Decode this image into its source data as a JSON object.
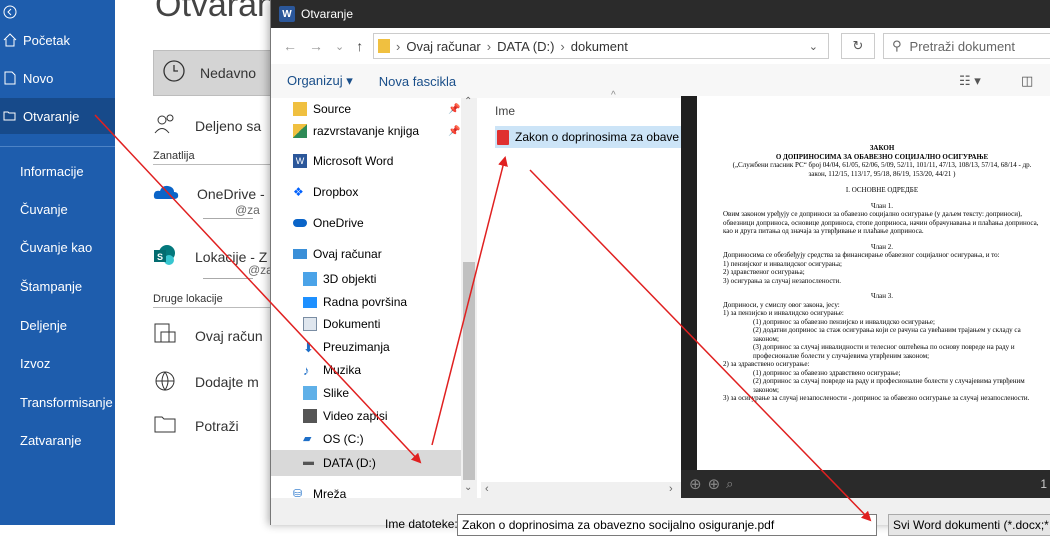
{
  "backstage": {
    "title": "Otvaranje",
    "nav": [
      {
        "label": "Početak",
        "icon": "home-icon"
      },
      {
        "label": "Novo",
        "icon": "new-document-icon"
      },
      {
        "label": "Otvaranje",
        "icon": "open-folder-icon",
        "selected": true
      },
      {
        "label": "Informacije"
      },
      {
        "label": "Čuvanje"
      },
      {
        "label": "Čuvanje kao"
      },
      {
        "label": "Štampanje"
      },
      {
        "label": "Deljenje"
      },
      {
        "label": "Izvoz"
      },
      {
        "label": "Transformisanje"
      },
      {
        "label": "Zatvaranje"
      }
    ],
    "recent_label": "Nedavno",
    "shared_label": "Deljeno sa",
    "group_zanatlija": "Zanatlija",
    "onedrive_label": "OneDrive -",
    "onedrive_sub": "@za",
    "locations_label": "Lokacije - Z",
    "locations_sub": "@za",
    "group_other": "Druge lokacije",
    "this_pc_label": "Ovaj račun",
    "add_place_label": "Dodajte m",
    "browse_label": "Potraži"
  },
  "dialog": {
    "title": "Otvaranje",
    "address": [
      "Ovaj računar",
      "DATA (D:)",
      "dokument"
    ],
    "search_placeholder": "Pretraži dokument",
    "organize_label": "Organizuj ▾",
    "new_folder_label": "Nova fascikla",
    "nav_items": [
      {
        "label": "Source",
        "icon": "folder-icon",
        "pinned": true
      },
      {
        "label": "razvrstavanje knjiga",
        "icon": "folder-icon",
        "pinned": true
      },
      {
        "label": "Microsoft Word",
        "icon": "word-icon"
      },
      {
        "label": "Dropbox",
        "icon": "dropbox-icon"
      },
      {
        "label": "OneDrive",
        "icon": "onedrive-icon"
      },
      {
        "label": "Ovaj računar",
        "icon": "computer-icon"
      },
      {
        "label": "3D objekti",
        "icon": "3d-objects-icon"
      },
      {
        "label": "Radna površina",
        "icon": "desktop-icon"
      },
      {
        "label": "Dokumenti",
        "icon": "documents-icon"
      },
      {
        "label": "Preuzimanja",
        "icon": "downloads-icon"
      },
      {
        "label": "Muzika",
        "icon": "music-icon"
      },
      {
        "label": "Slike",
        "icon": "pictures-icon"
      },
      {
        "label": "Video zapisi",
        "icon": "videos-icon"
      },
      {
        "label": "OS (C:)",
        "icon": "drive-icon"
      },
      {
        "label": "DATA (D:)",
        "icon": "drive-icon",
        "selected": true
      },
      {
        "label": "Mreža",
        "icon": "network-icon"
      }
    ],
    "column_header": "Ime",
    "file_name": "Zakon o doprinosima za obave",
    "filename_label": "Ime datoteke:",
    "filename_value": "Zakon o doprinosima za obavezno socijalno osiguranje.pdf",
    "filetype_value": "Svi Word dokumenti (*.docx;*.d",
    "preview_page_number": "1"
  },
  "preview": {
    "title": "ЗАКОН",
    "subtitle": "О ДОПРИНОСИМА ЗА ОБАВЕЗНО СОЦИЈАЛНО ОСИГУРАЊЕ",
    "gazette": "(„Службени гласник РС“ број 04/04, 61/05, 62/06, 5/09, 52/11, 101/11, 47/13, 108/13, 57/14, 68/14 - др. закон, 112/15, 113/17, 95/18, 86/19, 153/20, 44/21 )",
    "section1": "I. ОСНОВНЕ ОДРЕДБЕ",
    "clan1": "Члан 1.",
    "clan1_text": "Овим законом уређују се доприноси за обавезно социјално осигурање (у даљем тексту: доприноси), обвезници доприноса, основице доприноса, стопе доприноса, начин обрачунавања и плаћања доприноса, као и друга питања од значаја за утврђивање и плаћање доприноса.",
    "clan2": "Члан 2.",
    "clan2_text": "Доприносима се обезбеђују средства за финансирање обавезног социјалног осигурања, и то:",
    "clan2_l1": "1) пензијског и инвалидског осигурања;",
    "clan2_l2": "2) здравственог осигурања;",
    "clan2_l3": "3) осигурања за случај незапослености.",
    "clan3": "Члан 3.",
    "clan3_text": "Доприноси, у смислу овог закона, јесу:",
    "clan3_l1": "1) за пензијско и инвалидско осигурање:",
    "clan3_l1a": "(1) допринос за обавезно пензијско и инвалидско осигурање;",
    "clan3_l1b": "(2) додатни допринос за стаж осигурања који се рачуна са увећаним трајањем у складу са законом;",
    "clan3_l1c": "(3) допринос за случај инвалидности и телесног оштећења по основу повреде на раду и професионалне болести у случајевима утврђеним законом;",
    "clan3_l2": "2) за здравствено осигурање:",
    "clan3_l2a": "(1) допринос за обавезно здравствено осигурање;",
    "clan3_l2b": "(2) допринос за случај повреде на раду и професионалне болести у случајевима утврђеним законом;",
    "clan3_l3": "3) за осигурање за случај незапослености - допринос за обавезно осигурање за случај незапослености."
  },
  "colors": {
    "accent": "#1e5dad",
    "arrow": "#e02020"
  }
}
